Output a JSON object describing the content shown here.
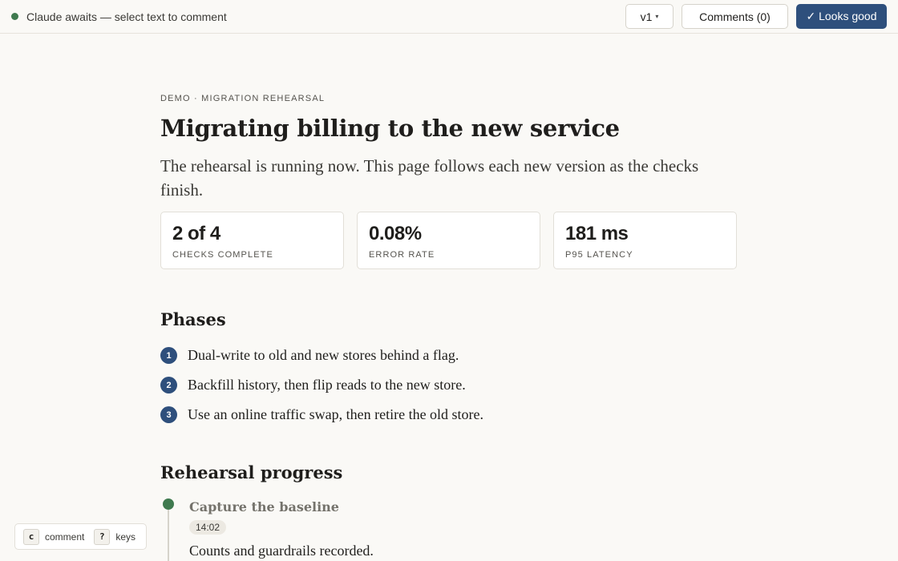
{
  "topbar": {
    "status_text": "Claude awaits — select text to comment",
    "status_color": "#3f7a4f",
    "version_label": "v1",
    "version_caret": "▾",
    "comments_label": "Comments (0)",
    "approve_label": "✓ Looks good",
    "accent_color": "#2e4f7c"
  },
  "doc": {
    "eyebrow": "DEMO · MIGRATION REHEARSAL",
    "title": "Migrating billing to the new service",
    "lead": "The rehearsal is running now. This page follows each new version as the checks finish.",
    "stats": [
      {
        "value": "2 of 4",
        "label": "CHECKS COMPLETE"
      },
      {
        "value": "0.08%",
        "label": "ERROR RATE"
      },
      {
        "value": "181 ms",
        "label": "P95 LATENCY"
      }
    ],
    "phases_title": "Phases",
    "phases": [
      {
        "num": "1",
        "text": "Dual-write to old and new stores behind a flag."
      },
      {
        "num": "2",
        "text": "Backfill history, then flip reads to the new store."
      },
      {
        "num": "3",
        "text": "Use an online traffic swap, then retire the old store."
      }
    ],
    "progress_title": "Rehearsal progress",
    "timeline": [
      {
        "title": "Capture the baseline",
        "time": "14:02",
        "desc": "Counts and guardrails recorded.",
        "status_color": "#3f7a4f"
      }
    ]
  },
  "keyhint": {
    "comment_key": "c",
    "comment_label": "comment",
    "keys_key": "?",
    "keys_label": "keys"
  }
}
